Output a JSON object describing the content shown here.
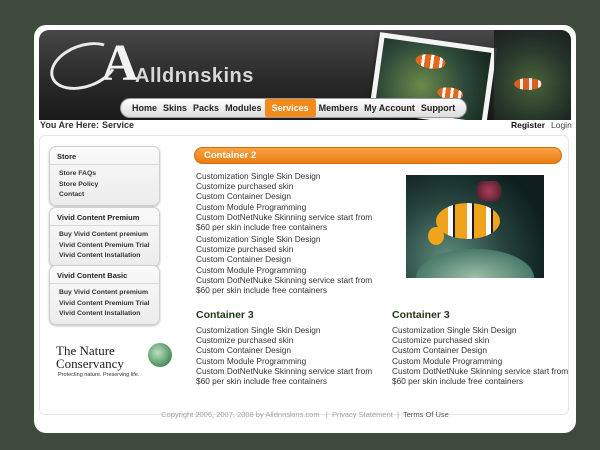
{
  "logo": {
    "text": "Alldnnskins"
  },
  "nav": {
    "items": [
      "Home",
      "Skins",
      "Packs",
      "Modules",
      "Services",
      "Members",
      "My Account",
      "Support"
    ],
    "active": "Services"
  },
  "breadcrumb": {
    "label": "You Are Here:",
    "page": "Service"
  },
  "auth": {
    "register": "Register",
    "login": "Login"
  },
  "sidebar": {
    "store": {
      "title": "Store",
      "items": [
        "Store FAQs",
        "Store Policy",
        "Contact"
      ]
    },
    "premium": {
      "title": "Vivid Content Premium",
      "items": [
        "Buy Vivid Content premium",
        "Vivid Content Premium Trial",
        "Vivid Content Installation"
      ]
    },
    "basic": {
      "title": "Vivid Content Basic",
      "items": [
        "Buy Vivid Content premium",
        "Vivid Content Premium Trial",
        "Vivid Content Installation"
      ]
    }
  },
  "sponsor": {
    "name_line1": "The Nature",
    "name_line2": "Conservancy",
    "tagline": "Protecting nature. Preserving life."
  },
  "container2": {
    "title": "Container 2",
    "block1": [
      "Customization Single Skin Design",
      "Customize purchased skin",
      "Custom Container Design",
      "Custom Module Programming",
      "Custom DotNetNuke Skinning service start from",
      "$60 per skin include free containers"
    ],
    "block2": [
      "Customization Single Skin Design",
      "Customize purchased skin",
      "Custom Container Design",
      "Custom Module Programming",
      "Custom DotNetNuke Skinning service start from",
      "$60 per skin include free containers"
    ]
  },
  "container3_left": {
    "title": "Container 3",
    "lines": [
      "Customization Single Skin Design",
      "Customize purchased skin",
      "Custom Container Design",
      "Custom Module Programming",
      "Custom DotNetNuke Skinning service start from",
      "$60 per skin include free containers"
    ]
  },
  "container3_right": {
    "title": "Container 3",
    "lines": [
      "Customization Single Skin Design",
      "Customize purchased skin",
      "Custom Container Design",
      "Custom Module Programming",
      "Custom DotNetNuke Skinning service start from",
      "$60 per skin include free containers"
    ]
  },
  "footer": {
    "copyright": "Copyright 2006, 2007, 2008 by Alldnnskins.com",
    "sep1": "|",
    "privacy": "Privacy Statement",
    "sep2": "|",
    "terms": "Terms Of Use"
  },
  "colors": {
    "accent": "#ec7c12",
    "heading": "#1f3a18",
    "background": "#3e4a3c"
  }
}
